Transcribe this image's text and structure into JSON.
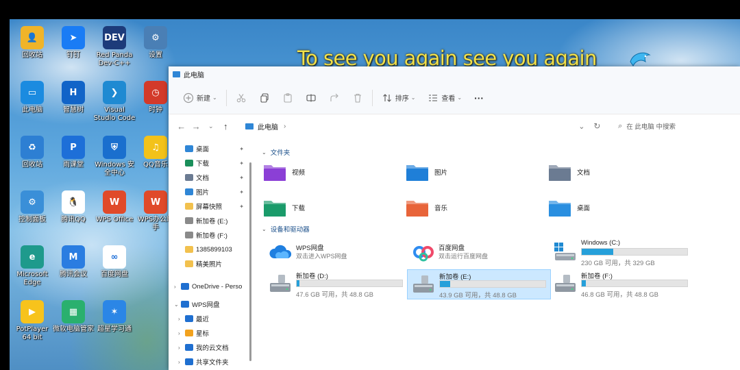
{
  "desktop": {
    "marquee": "To see you again see you again",
    "icons": [
      {
        "label": "回收站",
        "color": "#f0b429",
        "glyph": "👤"
      },
      {
        "label": "钉钉",
        "color": "#1a7cf5",
        "glyph": "➤"
      },
      {
        "label": "Red Panda Dev-C++",
        "color": "#1d3b7a",
        "glyph": "DEV"
      },
      {
        "label": "设置",
        "color": "#4a7fb5",
        "glyph": "⚙"
      },
      {
        "label": "此电脑",
        "color": "#1b8be0",
        "glyph": "▭"
      },
      {
        "label": "智慧树",
        "color": "#1164c8",
        "glyph": "H"
      },
      {
        "label": "Visual Studio Code",
        "color": "#1f8ad2",
        "glyph": "❯"
      },
      {
        "label": "时钟",
        "color": "#d33a2a",
        "glyph": "◷"
      },
      {
        "label": "回收站",
        "color": "#2d7fd3",
        "glyph": "♻"
      },
      {
        "label": "雨课堂",
        "color": "#1d6fd8",
        "glyph": "P"
      },
      {
        "label": "Windows 安全中心",
        "color": "#1a6fce",
        "glyph": "⛨"
      },
      {
        "label": "QQ音乐",
        "color": "#f3c21a",
        "glyph": "♫"
      },
      {
        "label": "控制面板",
        "color": "#3a8fd8",
        "glyph": "⚙"
      },
      {
        "label": "腾讯QQ",
        "color": "#ffffff",
        "glyph": "🐧"
      },
      {
        "label": "WPS Office",
        "color": "#e04a2a",
        "glyph": "W"
      },
      {
        "label": "WPS办公助手",
        "color": "#e04a2a",
        "glyph": "W"
      },
      {
        "label": "Microsoft Edge",
        "color": "#1e9a8c",
        "glyph": "e"
      },
      {
        "label": "腾讯会议",
        "color": "#2a7de1",
        "glyph": "M"
      },
      {
        "label": "百度网盘",
        "color": "#ffffff",
        "glyph": "∞"
      },
      {
        "label": "PotPlayer 64 bit",
        "color": "#f7c31c",
        "glyph": "▶"
      },
      {
        "label": "微软电脑管家",
        "color": "#2ab06e",
        "glyph": "▦"
      },
      {
        "label": "超星学习通",
        "color": "#2b86e6",
        "glyph": "✶"
      }
    ]
  },
  "explorer": {
    "title": "此电脑",
    "toolbar": {
      "new_label": "新建",
      "sort_label": "排序",
      "view_label": "查看",
      "more_label": "···"
    },
    "address": {
      "location": "此电脑",
      "separator": "›",
      "search_placeholder": "在 此电脑 中搜索"
    },
    "sidebar": [
      {
        "label": "桌面",
        "color": "#2f86d6",
        "pinned": true
      },
      {
        "label": "下载",
        "color": "#1a8f5a",
        "pinned": true
      },
      {
        "label": "文档",
        "color": "#6b7b92",
        "pinned": true
      },
      {
        "label": "图片",
        "color": "#2f86d6",
        "pinned": true
      },
      {
        "label": "屏幕快照",
        "color": "#f2c14e",
        "pinned": true
      },
      {
        "label": "新加卷 (E:)",
        "color": "#8a8a8a",
        "pinned": false
      },
      {
        "label": "新加卷 (F:)",
        "color": "#8a8a8a",
        "pinned": false
      },
      {
        "label": "1385899103",
        "color": "#f2c14e",
        "pinned": false
      },
      {
        "label": "精美照片",
        "color": "#f2c14e",
        "pinned": false
      },
      {
        "label": "OneDrive - Perso",
        "color": "#1f6fd0",
        "pinned": false
      },
      {
        "label": "WPS网盘",
        "color": "#1f6fd0",
        "pinned": false
      },
      {
        "label": "最近",
        "color": "#1f6fd0",
        "pinned": false
      },
      {
        "label": "星标",
        "color": "#f2a21e",
        "pinned": false
      },
      {
        "label": "我的云文档",
        "color": "#1f6fd0",
        "pinned": false
      },
      {
        "label": "共享文件夹",
        "color": "#1f6fd0",
        "pinned": false
      }
    ],
    "folders_header": "文件夹",
    "folders": [
      {
        "label": "视频",
        "color": "#8b3fd6"
      },
      {
        "label": "图片",
        "color": "#1f7fd8"
      },
      {
        "label": "文档",
        "color": "#6b7b92"
      },
      {
        "label": "下载",
        "color": "#1a9b6a"
      },
      {
        "label": "音乐",
        "color": "#e8643a"
      },
      {
        "label": "桌面",
        "color": "#2a8fe0"
      }
    ],
    "devices_header": "设备和驱动器",
    "clouds": [
      {
        "name": "WPS网盘",
        "sub": "双击进入WPS网盘"
      },
      {
        "name": "百度网盘",
        "sub": "双击运行百度网盘"
      }
    ],
    "drives": [
      {
        "name": "Windows (C:)",
        "free": "230 GB 可用，共 329 GB",
        "used_fraction": 0.3
      },
      {
        "name": "新加卷 (D:)",
        "free": "47.6 GB 可用，共 48.8 GB",
        "used_fraction": 0.025
      },
      {
        "name": "新加卷 (E:)",
        "free": "43.9 GB 可用，共 48.8 GB",
        "used_fraction": 0.1
      },
      {
        "name": "新加卷 (F:)",
        "free": "46.8 GB 可用，共 48.8 GB",
        "used_fraction": 0.04
      }
    ]
  }
}
